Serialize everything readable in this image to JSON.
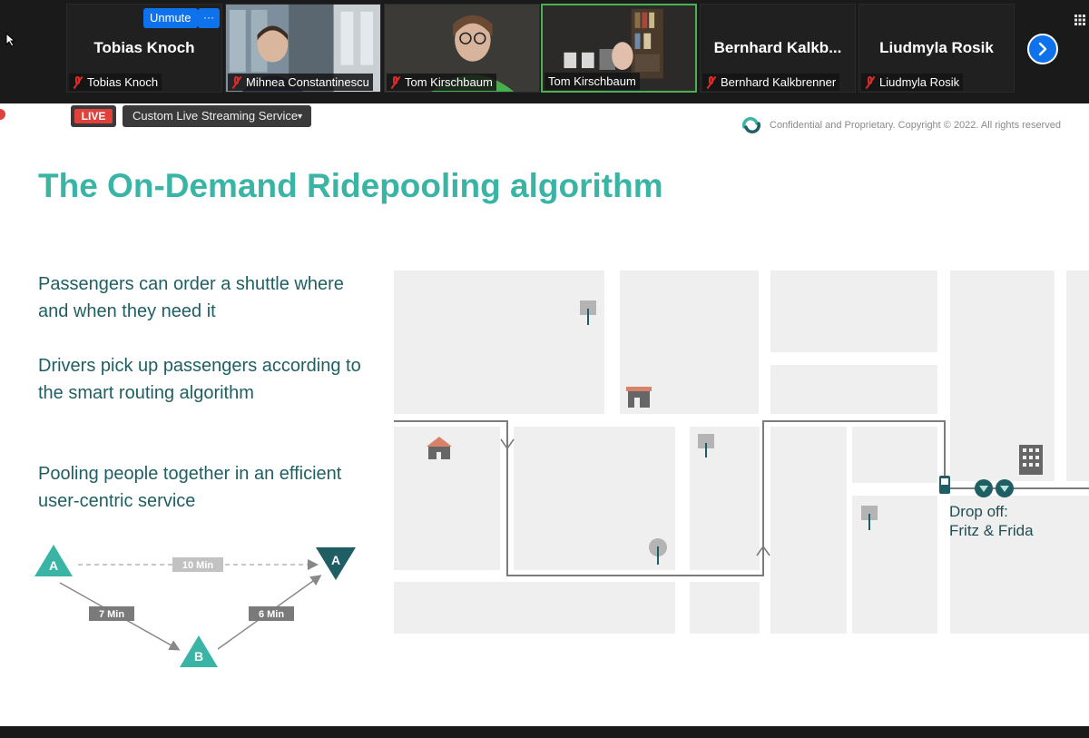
{
  "toolbar": {
    "unmute_label": "Unmute",
    "more_label": "···"
  },
  "participants": [
    {
      "display_name": "Tobias Knoch",
      "label": "Tobias Knoch",
      "muted": true,
      "video": false
    },
    {
      "display_name": "",
      "label": "Mihnea Constantinescu",
      "muted": true,
      "video": true
    },
    {
      "display_name": "",
      "label": "Tom Kirschbaum",
      "muted": true,
      "video": true
    },
    {
      "display_name": "",
      "label": "Tom Kirschbaum",
      "muted": false,
      "video": true,
      "active_speaker": true
    },
    {
      "display_name": "Bernhard  Kalkb...",
      "label": "Bernhard Kalkbrenner",
      "muted": true,
      "video": false
    },
    {
      "display_name": "Liudmyla Rosik",
      "label": "Liudmyla Rosik",
      "muted": true,
      "video": false
    }
  ],
  "stream": {
    "live_label": "LIVE",
    "service_label": "Custom Live Streaming Service"
  },
  "slide": {
    "copyright": "Confidential and Proprietary. Copyright © 2022. All rights reserved",
    "title": "The On-Demand Ridepooling algorithm",
    "paragraphs": [
      "Passengers can order a shuttle where and when they need it",
      "Drivers pick up passengers according to the smart routing algorithm",
      "Pooling people together in an efficient user-centric service"
    ],
    "diagram": {
      "node_a": "A",
      "node_b": "B",
      "node_a_dest": "A",
      "direct_time": "10 Min",
      "a_to_b_time": "7 Min",
      "b_to_a_time": "6 Min"
    },
    "map": {
      "dropoff_line1": "Drop off:",
      "dropoff_line2": "Fritz & Frida"
    }
  },
  "colors": {
    "teal": "#3ab5a5",
    "dark_teal": "#1f5f63",
    "zoom_blue": "#0e72ed",
    "live_red": "#e0413b"
  }
}
